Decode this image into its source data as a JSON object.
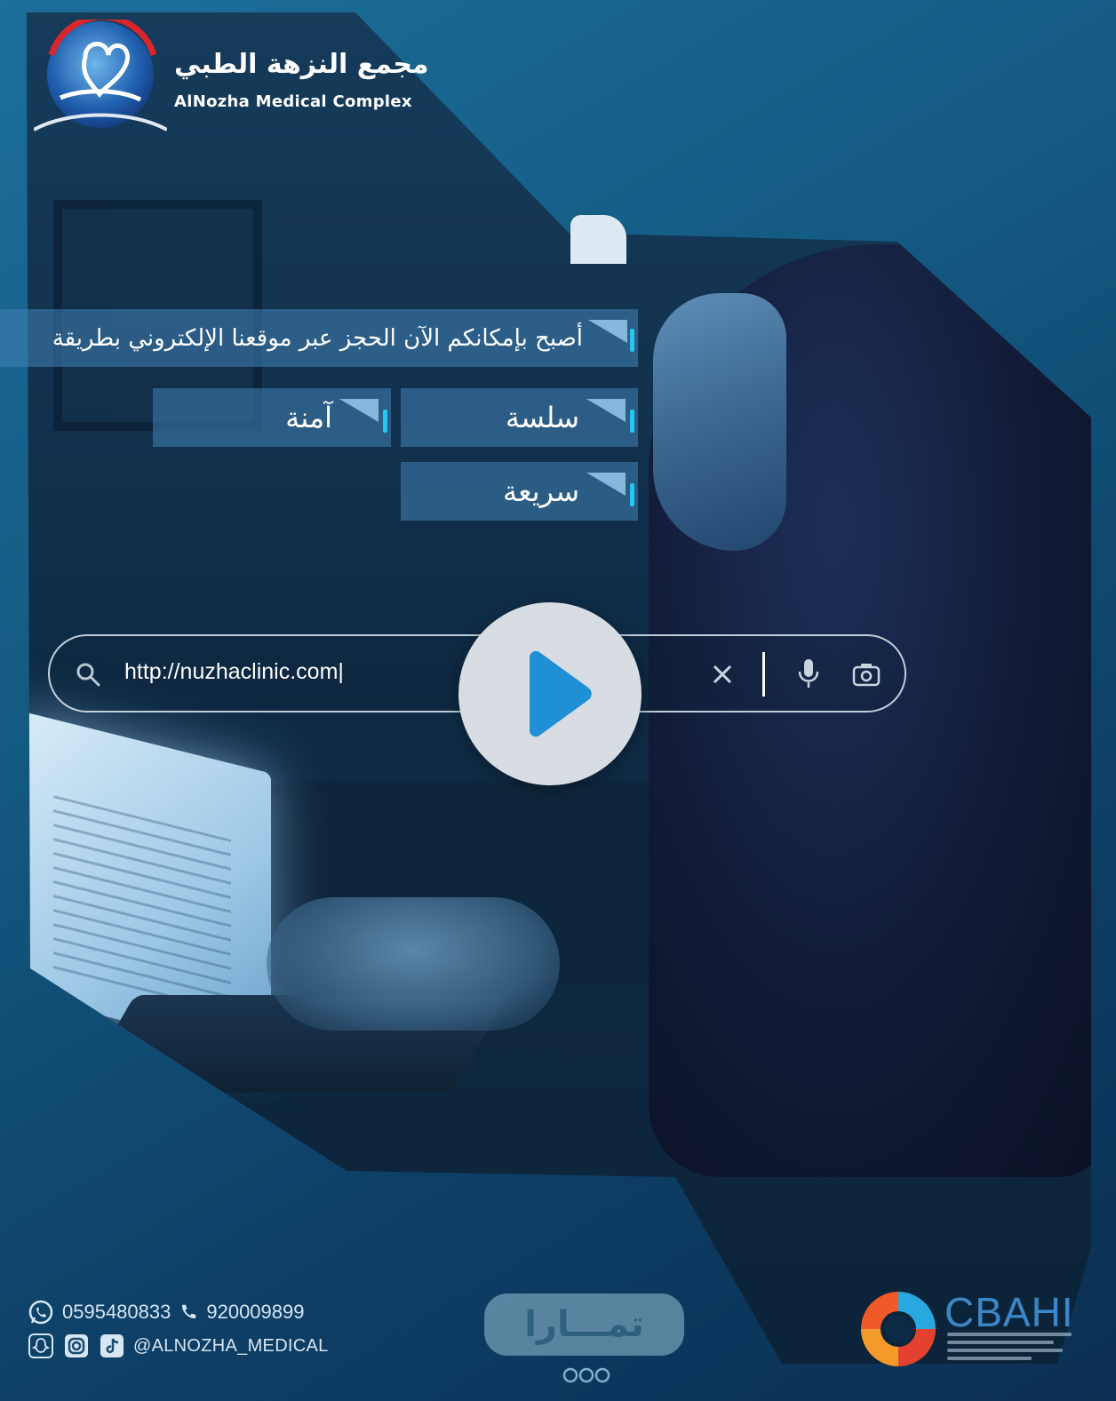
{
  "brand": {
    "name_ar": "مجمع النزهة الطبي",
    "name_en": "AlNozha Medical Complex",
    "accent_color": "#27c6f0"
  },
  "banners": {
    "main": "أصبح بإمكانكم الآن الحجز عبر موقعنا الإلكتروني بطريقة",
    "smooth": "سلسة",
    "safe": "آمنة",
    "fast": "سريعة"
  },
  "search": {
    "url_value": "http://nuzhaclinic.com|",
    "icons": [
      "search-icon",
      "clear-icon",
      "mic-icon",
      "camera-icon"
    ]
  },
  "video": {
    "control": "play-icon"
  },
  "contact": {
    "whatsapp": "0595480833",
    "phone": "920009899",
    "handle": "@ALNOZHA_MEDICAL",
    "icons": [
      "whatsapp-icon",
      "phone-icon",
      "snapchat-icon",
      "instagram-icon",
      "tiktok-icon"
    ]
  },
  "partners": {
    "tamara": "تمـــارا",
    "cbahi": "CBAHI"
  }
}
